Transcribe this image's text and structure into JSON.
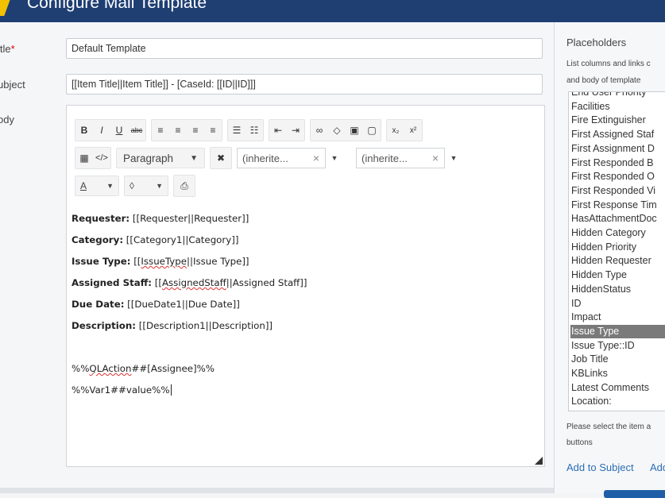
{
  "window": {
    "title": "Configure Mail Template"
  },
  "form": {
    "title_label": "itle",
    "required_mark": "*",
    "title_value": "Default Template",
    "subject_label": "ubject",
    "subject_value": "[[Item Title||Item Title]] - [CaseId: [[ID||ID]]]",
    "body_label": "ody"
  },
  "toolbar": {
    "row1": [
      {
        "name": "bold-button",
        "glyph": "B"
      },
      {
        "name": "italic-button",
        "glyph": "I"
      },
      {
        "name": "underline-button",
        "glyph": "U"
      },
      {
        "name": "strikethrough-button",
        "glyph": "abc"
      },
      {
        "name": "align-left-button",
        "glyph": "≡"
      },
      {
        "name": "align-center-button",
        "glyph": "≡"
      },
      {
        "name": "align-right-button",
        "glyph": "≡"
      },
      {
        "name": "align-justify-button",
        "glyph": "≡"
      },
      {
        "name": "bullet-list-button",
        "glyph": "☰"
      },
      {
        "name": "numbered-list-button",
        "glyph": "☷"
      },
      {
        "name": "outdent-button",
        "glyph": "⇤"
      },
      {
        "name": "indent-button",
        "glyph": "⇥"
      },
      {
        "name": "link-button",
        "glyph": "∞"
      },
      {
        "name": "unlink-button",
        "glyph": "◇"
      },
      {
        "name": "image-button",
        "glyph": "▣"
      },
      {
        "name": "file-button",
        "glyph": "▢"
      },
      {
        "name": "subscript-button",
        "glyph": "x₂"
      },
      {
        "name": "superscript-button",
        "glyph": "x²"
      }
    ],
    "paragraph_label": "Paragraph",
    "font_family_value": "(inherite...",
    "font_size_value": "(inherite...",
    "font_color_label": "A",
    "clear_glyph": "×",
    "dropdown_glyph": "▼"
  },
  "body": {
    "lines": [
      {
        "label": "Requester:",
        "value": " [[Requester||Requester]]"
      },
      {
        "label": "Category:",
        "value": " [[Category1||Category]]"
      },
      {
        "label": "Issue Type:",
        "value_pre": " [[",
        "value_squig": "IssueType",
        "value_post": "||Issue Type]]"
      },
      {
        "label": "Assigned Staff:",
        "value_pre": " [[",
        "value_squig": "AssignedStaff",
        "value_post": "||Assigned Staff]]"
      },
      {
        "label": "Due Date:",
        "value": " [[DueDate1||Due Date]]"
      },
      {
        "label": "Description:",
        "value": " [[Description1||Description]]"
      }
    ],
    "action_pre": "%%",
    "action_squig": "QLAction",
    "action_post": "##[Assignee]%%",
    "var_line": "%%Var1##value%%"
  },
  "placeholders": {
    "title": "Placeholders",
    "hint_line1": "List columns and links c",
    "hint_line2": "and body of template",
    "items": [
      "End User Priority",
      "Facilities",
      "Fire Extinguisher",
      "First Assigned Staf",
      "First Assignment D",
      "First Responded B",
      "First Responded O",
      "First Responded Vi",
      "First Response Tim",
      "HasAttachmentDoc",
      "Hidden Category",
      "Hidden Priority",
      "Hidden Requester",
      "Hidden Type",
      "HiddenStatus",
      "ID",
      "Impact",
      "Issue Type",
      "Issue Type::ID",
      "Job Title",
      "KBLinks",
      "Latest Comments",
      "Location:"
    ],
    "selected_item": "Issue Type",
    "footer_line1": "Please select the item a",
    "footer_line2": "buttons",
    "add_to_subject": "Add to Subject",
    "add_other": "Add"
  },
  "colors": {
    "titlebar": "#1f3f73",
    "accent": "#f2c200",
    "link": "#2a6fb5",
    "selection": "#7a7a7a"
  }
}
